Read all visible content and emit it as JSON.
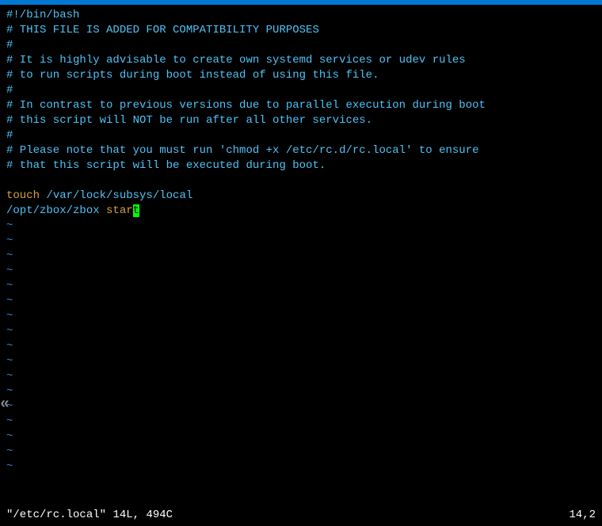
{
  "file": {
    "lines": [
      {
        "type": "comment",
        "text": "#!/bin/bash"
      },
      {
        "type": "comment",
        "text": "# THIS FILE IS ADDED FOR COMPATIBILITY PURPOSES"
      },
      {
        "type": "comment",
        "text": "#"
      },
      {
        "type": "comment",
        "text": "# It is highly advisable to create own systemd services or udev rules"
      },
      {
        "type": "comment",
        "text": "# to run scripts during boot instead of using this file."
      },
      {
        "type": "comment",
        "text": "#"
      },
      {
        "type": "comment",
        "text": "# In contrast to previous versions due to parallel execution during boot"
      },
      {
        "type": "comment",
        "text": "# this script will NOT be run after all other services."
      },
      {
        "type": "comment",
        "text": "#"
      },
      {
        "type": "comment",
        "text": "# Please note that you must run 'chmod +x /etc/rc.d/rc.local' to ensure"
      },
      {
        "type": "comment",
        "text": "# that this script will be executed during boot."
      },
      {
        "type": "blank",
        "text": ""
      },
      {
        "type": "touch",
        "cmd": "touch",
        "arg": " /var/lock/subsys/local"
      },
      {
        "type": "start",
        "path": "/opt/zbox/zbox ",
        "cmd": "star",
        "cursor": "t"
      }
    ]
  },
  "tildes_count": 17,
  "scroll_hint": "«",
  "status": {
    "filename": "\"/etc/rc.local\"",
    "info": "14L, 494C",
    "position": "14,2"
  }
}
